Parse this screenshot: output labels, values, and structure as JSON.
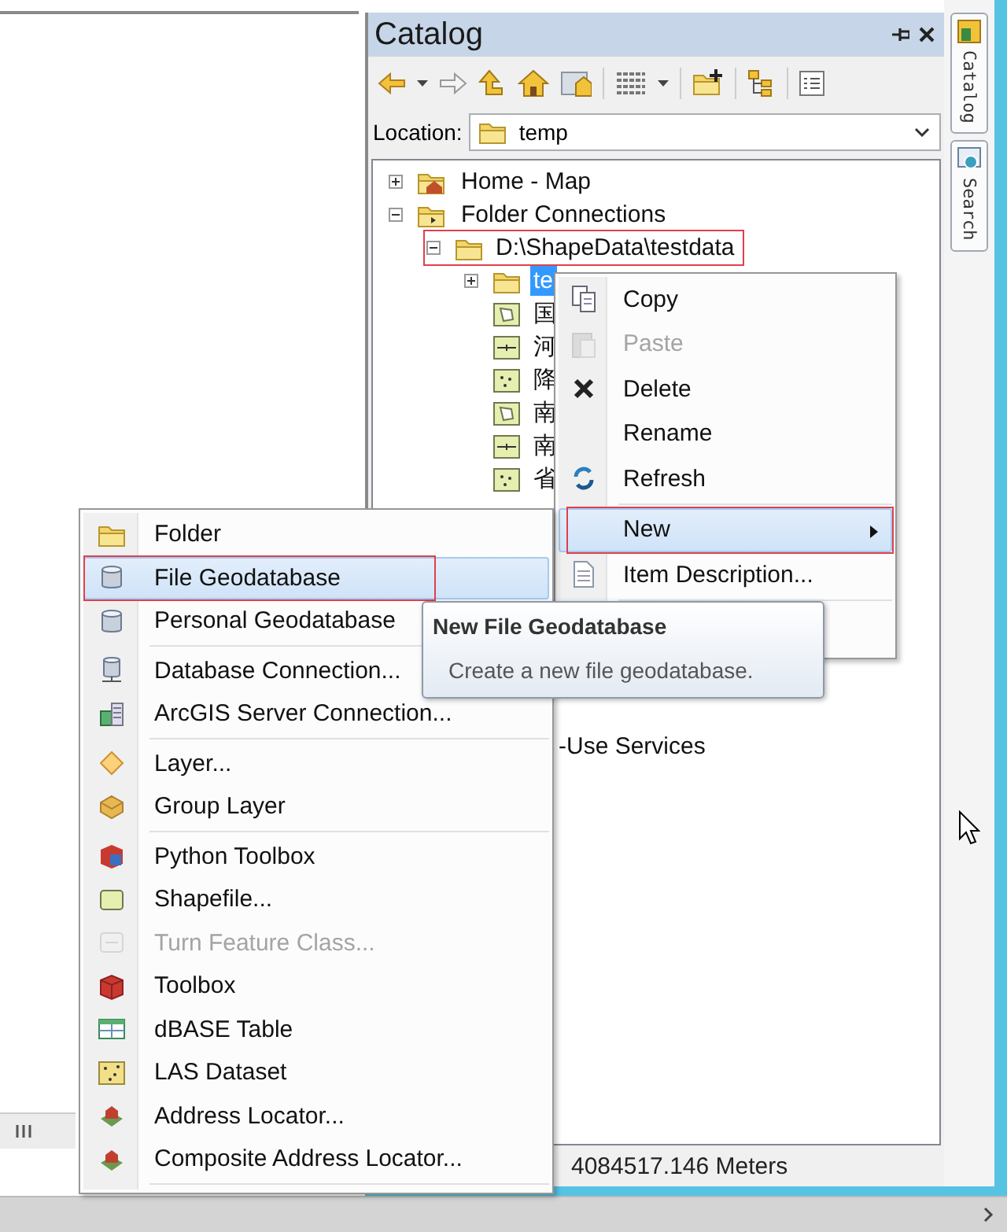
{
  "catalog": {
    "title": "Catalog",
    "location": {
      "label": "Location:",
      "value": "temp"
    },
    "tree": [
      {
        "label": "Home - Map",
        "kind": "home",
        "expanded": false
      },
      {
        "label": "Folder Connections",
        "kind": "connections",
        "expanded": true,
        "children": [
          {
            "label": "D:\\ShapeData\\testdata",
            "kind": "folder",
            "expanded": true,
            "annotated": true,
            "children": [
              {
                "label": "te",
                "kind": "folder",
                "expanded": false,
                "selected": true
              },
              {
                "label": "国",
                "kind": "polygon",
                "selected": false
              },
              {
                "label": "河",
                "kind": "line",
                "selected": false
              },
              {
                "label": "降",
                "kind": "point",
                "selected": false
              },
              {
                "label": "南",
                "kind": "polygon",
                "selected": false
              },
              {
                "label": "南",
                "kind": "line",
                "selected": false
              },
              {
                "label": "省",
                "kind": "point",
                "selected": false
              }
            ]
          }
        ]
      }
    ],
    "partly_hidden_item": "-Use Services",
    "status": "4084517.146 Meters"
  },
  "side_tabs": [
    {
      "label": "Catalog",
      "kind": "catalog"
    },
    {
      "label": "Search",
      "kind": "search"
    }
  ],
  "context_menu": {
    "items": [
      {
        "label": "Copy",
        "kind": "copy",
        "disabled": false,
        "selected": false
      },
      {
        "label": "Paste",
        "kind": "paste",
        "disabled": true,
        "selected": false
      },
      {
        "label": "Delete",
        "kind": "delete",
        "disabled": false,
        "selected": false
      },
      {
        "label": "Rename",
        "kind": "none",
        "disabled": false,
        "selected": false
      },
      {
        "label": "Refresh",
        "kind": "refresh",
        "disabled": false,
        "selected": false
      },
      {
        "kind": "separator"
      },
      {
        "label": "New",
        "kind": "none",
        "submenu": true,
        "disabled": false,
        "selected": true,
        "annotated": true
      },
      {
        "label": "Item Description...",
        "kind": "description",
        "disabled": false,
        "selected": false
      },
      {
        "kind": "separator"
      }
    ]
  },
  "new_submenu": {
    "items": [
      {
        "label": "Folder",
        "kind": "folder",
        "disabled": false,
        "selected": false
      },
      {
        "label": "File Geodatabase",
        "kind": "geodatabase",
        "disabled": false,
        "selected": true,
        "annotated": true
      },
      {
        "label": "Personal Geodatabase",
        "kind": "geodatabase",
        "disabled": false,
        "selected": false
      },
      {
        "kind": "separator"
      },
      {
        "label": "Database Connection...",
        "kind": "dbconnection",
        "disabled": false,
        "selected": false
      },
      {
        "label": "ArcGIS Server Connection...",
        "kind": "server",
        "disabled": false,
        "selected": false
      },
      {
        "kind": "separator"
      },
      {
        "label": "Layer...",
        "kind": "layer",
        "disabled": false,
        "selected": false
      },
      {
        "label": "Group Layer",
        "kind": "grouplayer",
        "disabled": false,
        "selected": false
      },
      {
        "kind": "separator"
      },
      {
        "label": "Python Toolbox",
        "kind": "pytoolbox",
        "disabled": false,
        "selected": false
      },
      {
        "label": "Shapefile...",
        "kind": "shapefile",
        "disabled": false,
        "selected": false
      },
      {
        "label": "Turn Feature Class...",
        "kind": "turnfeature",
        "disabled": true,
        "selected": false
      },
      {
        "label": "Toolbox",
        "kind": "toolbox",
        "disabled": false,
        "selected": false
      },
      {
        "label": "dBASE Table",
        "kind": "table",
        "disabled": false,
        "selected": false
      },
      {
        "label": "LAS Dataset",
        "kind": "las",
        "disabled": false,
        "selected": false
      },
      {
        "label": "Address Locator...",
        "kind": "locator",
        "disabled": false,
        "selected": false
      },
      {
        "label": "Composite Address Locator...",
        "kind": "locator",
        "disabled": false,
        "selected": false
      },
      {
        "kind": "separator"
      }
    ]
  },
  "tooltip": {
    "title": "New File Geodatabase",
    "text": "Create a new file geodatabase."
  }
}
